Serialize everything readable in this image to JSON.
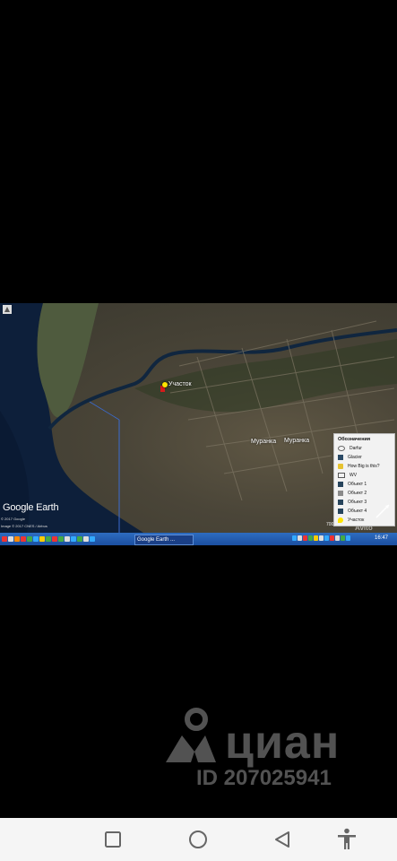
{
  "photo": {
    "logo_text": "Google Earth",
    "copyright_1": "© 2017 Google",
    "copyright_2": "Image © 2017 CNES / Airbus",
    "scale": "700 m",
    "avito": "Avito",
    "labels": {
      "uchastok": "Участок",
      "village": "Муранка"
    },
    "legend": {
      "title": "Обозначения",
      "items": [
        {
          "label": "Darfur",
          "icon": "darfur-icon"
        },
        {
          "label": "Glacier",
          "icon": "glacier-icon"
        },
        {
          "label": "How Big is this?",
          "icon": "folder-icon"
        },
        {
          "label": "WV",
          "icon": "wv-icon"
        },
        {
          "label": "Объект 1",
          "icon": "object-icon"
        },
        {
          "label": "Объект 2",
          "icon": "object-icon"
        },
        {
          "label": "Объект 3",
          "icon": "object-icon"
        },
        {
          "label": "Объект 4",
          "icon": "object-icon"
        },
        {
          "label": "Участок",
          "icon": "pin-icon"
        }
      ]
    },
    "taskbar": {
      "task_label": "Google Earth ...",
      "clock": "16:47"
    }
  },
  "watermark": {
    "brand": "циан",
    "id": "ID 207025941"
  },
  "colors": {
    "background": "#000000",
    "navbar": "#f5f5f5",
    "taskbar": "#1b4fa0",
    "pin": "#ffe500"
  }
}
